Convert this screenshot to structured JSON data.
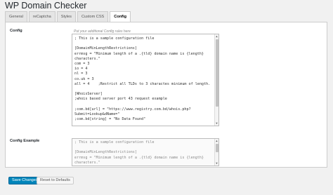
{
  "page": {
    "title": "WP Domain Checker"
  },
  "tabs": [
    {
      "label": "General",
      "active": false
    },
    {
      "label": "reCaptcha",
      "active": false
    },
    {
      "label": "Styles",
      "active": false
    },
    {
      "label": "Custom CSS",
      "active": false
    },
    {
      "label": "Config",
      "active": true
    }
  ],
  "config": {
    "label": "Config",
    "hint": "Put your additional Config rules here",
    "lines": [
      "; This is a sample configuration file",
      "",
      "[DomainMinLengthRestrictions]",
      "errmsg = \"Minimum length of a .{tld} domain name is {length}",
      "characters.\"",
      "com = 3",
      "io = 4",
      "nl = 3",
      "co.uk = 3",
      "all = 4    ;Restrict all TLDs to 3 charactes minimum of length.",
      "",
      "[WhoisServer]",
      ";whois based server port 43 request example",
      "",
      ";com.bd[url] = \"https://www.registry.com.bd/whois.php?",
      "Submit=Lookup&dName=\"",
      ";com.bd[string] = \"No Data Found\""
    ]
  },
  "config_example": {
    "label": "Config Example",
    "lines": [
      "; This is a sample configuration file",
      "",
      "[DomainMinLengthRestrictions]",
      "errmsg = \"Minimum length of a .{tld} domain name is {length}",
      "characters.\""
    ]
  },
  "buttons": {
    "save_label": "Save Changes",
    "reset_label": "Reset to Defaults"
  },
  "colors": {
    "primary": "#0085ba",
    "background": "#f1f1f1"
  }
}
